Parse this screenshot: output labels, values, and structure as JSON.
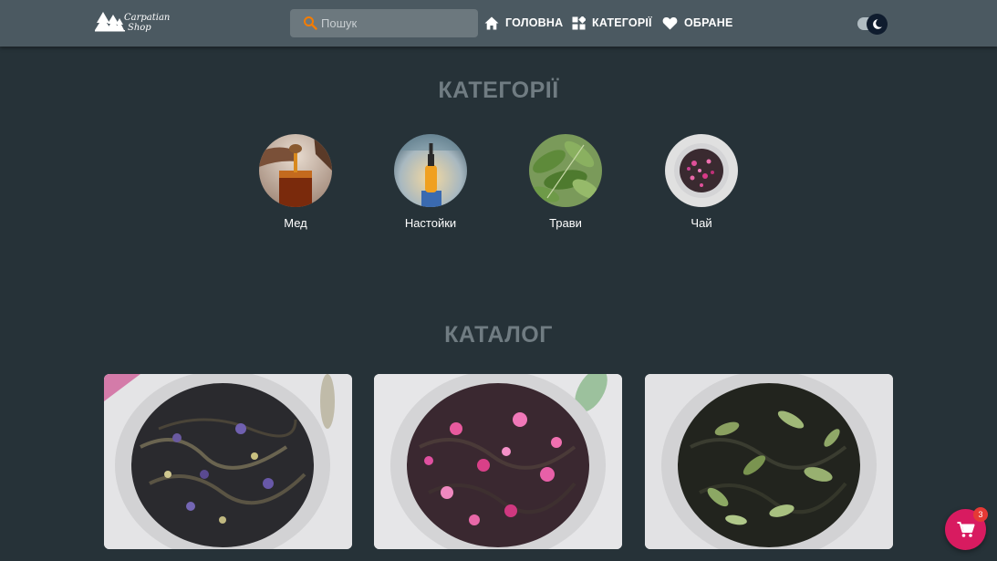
{
  "header": {
    "logo": {
      "line1": "Carpatian",
      "line2": "Shop"
    },
    "search": {
      "placeholder": "Пошук",
      "value": ""
    },
    "nav": {
      "home": "ГОЛОВНА",
      "categories": "КАТЕГОРІЇ",
      "favorites": "ОБРАНЕ"
    },
    "theme_toggle": {
      "icon": "moon-icon",
      "state": "dark"
    }
  },
  "categories_section": {
    "title": "КАТЕГОРІЇ",
    "items": [
      {
        "label": "Мед",
        "icon": "honey-jar-image"
      },
      {
        "label": "Настойки",
        "icon": "tincture-bottle-image"
      },
      {
        "label": "Трави",
        "icon": "herb-leaves-image"
      },
      {
        "label": "Чай",
        "icon": "tea-rose-image"
      }
    ]
  },
  "catalog_section": {
    "title": "КАТАЛОГ",
    "products": [
      {
        "image": "tea-cornflower-image"
      },
      {
        "image": "tea-rose-petals-image"
      },
      {
        "image": "tea-mint-image"
      }
    ]
  },
  "cart": {
    "count": "3",
    "icon": "cart-icon"
  },
  "colors": {
    "background": "#263238",
    "header": "#4b5961",
    "section_title": "#707c82",
    "cart_accent": "#d81b60",
    "search_accent": "#f57c00"
  }
}
